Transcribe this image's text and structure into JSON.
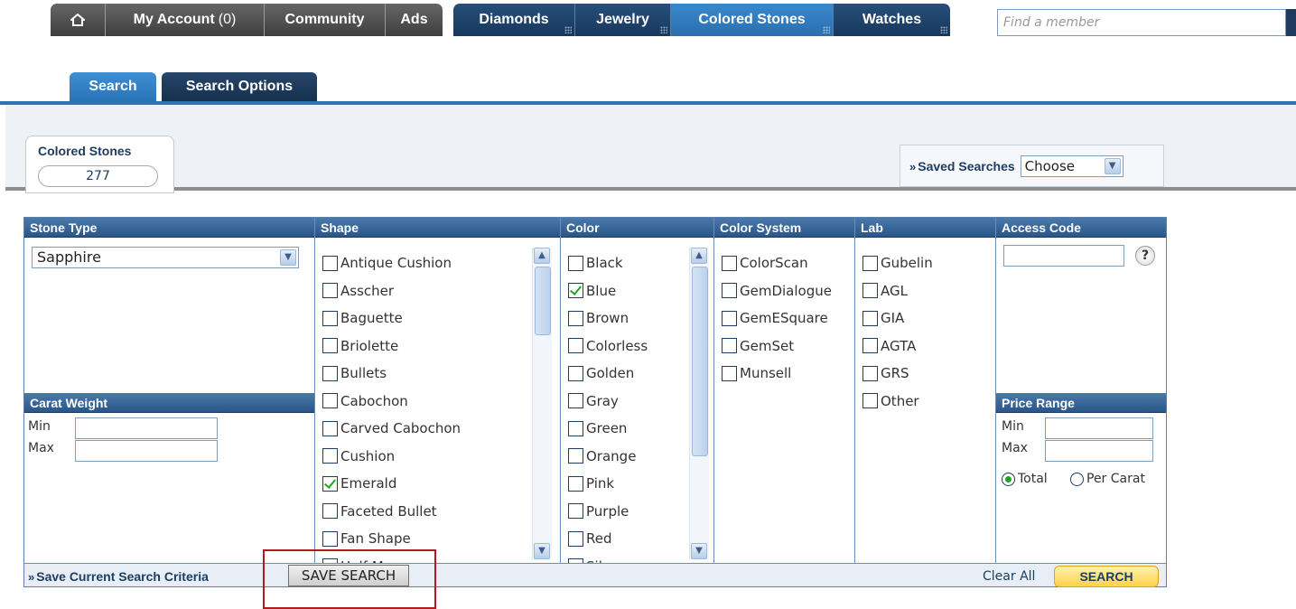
{
  "topnav": {
    "home_icon": "home-icon",
    "my_account": "My Account",
    "my_account_count": "(0)",
    "community": "Community",
    "ads": "Ads",
    "diamonds": "Diamonds",
    "jewelry": "Jewelry",
    "colored_stones": "Colored Stones",
    "watches": "Watches",
    "find_member_placeholder": "Find a member"
  },
  "subtabs": {
    "search": "Search",
    "search_options": "Search Options"
  },
  "summary": {
    "category": "Colored Stones",
    "count": "277"
  },
  "saved_searches": {
    "label": "Saved Searches",
    "selected": "Choose"
  },
  "filters": {
    "stone_type": {
      "header": "Stone Type",
      "selected": "Sapphire"
    },
    "carat_weight": {
      "header": "Carat Weight",
      "min_label": "Min",
      "max_label": "Max"
    },
    "shape": {
      "header": "Shape",
      "options": [
        {
          "label": "Antique Cushion",
          "checked": false
        },
        {
          "label": "Asscher",
          "checked": false
        },
        {
          "label": "Baguette",
          "checked": false
        },
        {
          "label": "Briolette",
          "checked": false
        },
        {
          "label": "Bullets",
          "checked": false
        },
        {
          "label": "Cabochon",
          "checked": false
        },
        {
          "label": "Carved Cabochon",
          "checked": false
        },
        {
          "label": "Cushion",
          "checked": false
        },
        {
          "label": "Emerald",
          "checked": true
        },
        {
          "label": "Faceted Bullet",
          "checked": false
        },
        {
          "label": "Fan Shape",
          "checked": false
        },
        {
          "label": "Half Moon",
          "checked": false
        }
      ]
    },
    "color": {
      "header": "Color",
      "options": [
        {
          "label": "Black",
          "checked": false
        },
        {
          "label": "Blue",
          "checked": true
        },
        {
          "label": "Brown",
          "checked": false
        },
        {
          "label": "Colorless",
          "checked": false
        },
        {
          "label": "Golden",
          "checked": false
        },
        {
          "label": "Gray",
          "checked": false
        },
        {
          "label": "Green",
          "checked": false
        },
        {
          "label": "Orange",
          "checked": false
        },
        {
          "label": "Pink",
          "checked": false
        },
        {
          "label": "Purple",
          "checked": false
        },
        {
          "label": "Red",
          "checked": false
        },
        {
          "label": "Silver",
          "checked": false
        }
      ]
    },
    "color_system": {
      "header": "Color System",
      "options": [
        {
          "label": "ColorScan",
          "checked": false
        },
        {
          "label": "GemDialogue",
          "checked": false
        },
        {
          "label": "GemESquare",
          "checked": false
        },
        {
          "label": "GemSet",
          "checked": false
        },
        {
          "label": "Munsell",
          "checked": false
        }
      ]
    },
    "lab": {
      "header": "Lab",
      "options": [
        {
          "label": "Gubelin",
          "checked": false
        },
        {
          "label": "AGL",
          "checked": false
        },
        {
          "label": "GIA",
          "checked": false
        },
        {
          "label": "AGTA",
          "checked": false
        },
        {
          "label": "GRS",
          "checked": false
        },
        {
          "label": "Other",
          "checked": false
        }
      ]
    },
    "access_code": {
      "header": "Access Code",
      "help": "?"
    },
    "price_range": {
      "header": "Price Range",
      "min_label": "Min",
      "max_label": "Max",
      "total_label": "Total",
      "per_carat_label": "Per Carat",
      "selected": "Total"
    }
  },
  "footer": {
    "save_label": "Save Current Search Criteria",
    "save_button": "SAVE SEARCH",
    "clear_all": "Clear All",
    "search_button": "SEARCH"
  },
  "colors": {
    "nav_blue": "#17385c",
    "accent_blue": "#2a74b8",
    "highlight_red": "#b01c1c",
    "search_yellow": "#ffd14a"
  }
}
